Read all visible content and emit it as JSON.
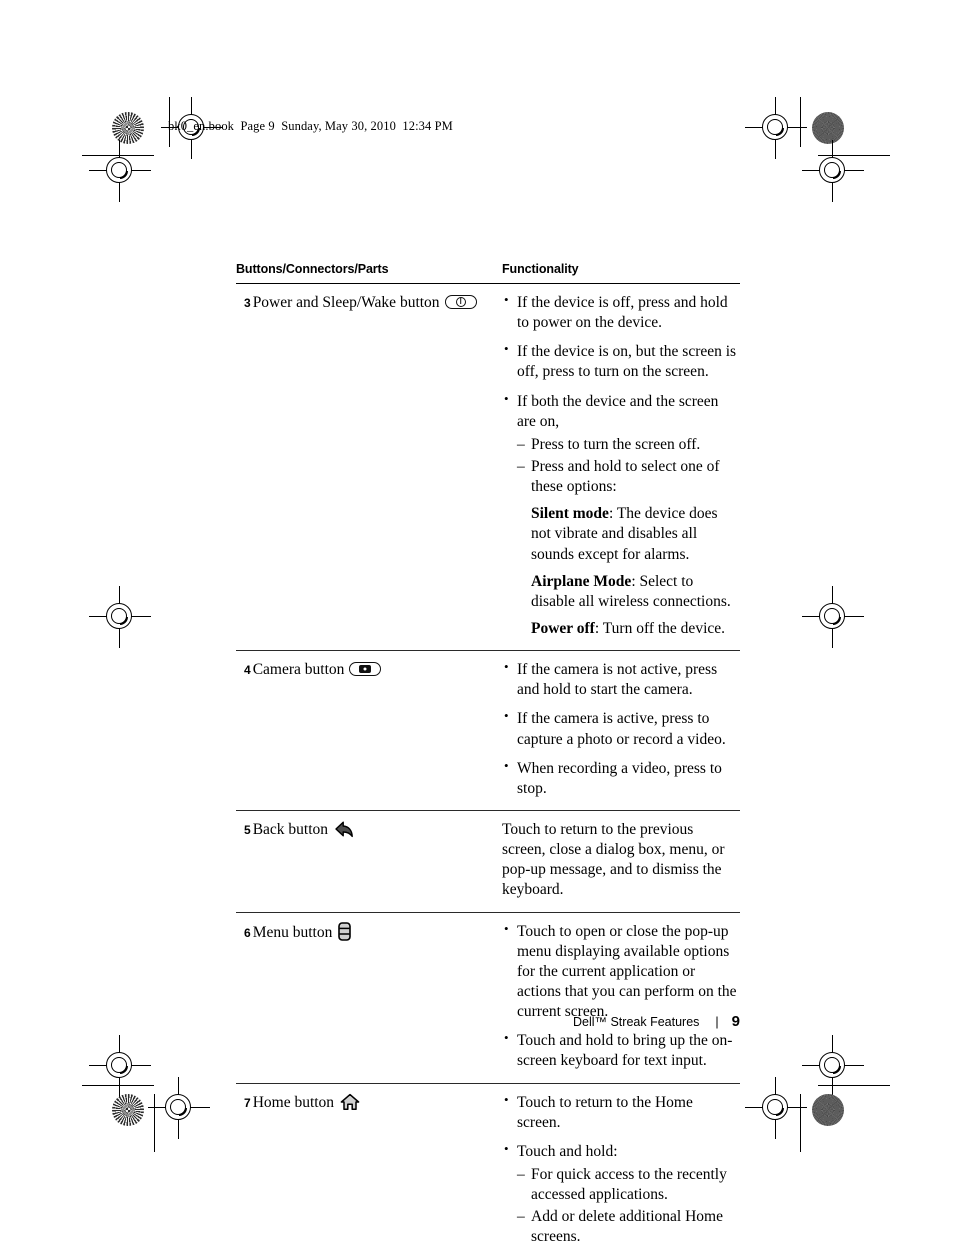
{
  "header": {
    "book_meta": "bk0_en.book  Page 9  Sunday, May 30, 2010  12:34 PM"
  },
  "table": {
    "columns": {
      "parts": "Buttons/Connectors/Parts",
      "functionality": "Functionality"
    },
    "rows": [
      {
        "number": "3",
        "label": "Power and Sleep/Wake button",
        "icon": "power-button-icon",
        "bullets": [
          "If the device is off, press and hold to power on the device.",
          "If the device is on, but the screen is off, press to turn on the screen.",
          "If both the device and the screen are on,"
        ],
        "sub_dashes": [
          "Press to turn the screen off.",
          "Press and hold to select one of these options:"
        ],
        "options": [
          {
            "term": "Silent mode",
            "desc": ": The device does not vibrate and disables all sounds except for alarms."
          },
          {
            "term": "Airplane Mode",
            "desc": ": Select to disable all wireless connections."
          },
          {
            "term": "Power off",
            "desc": ": Turn off the device."
          }
        ]
      },
      {
        "number": "4",
        "label": "Camera button",
        "icon": "camera-button-icon",
        "bullets": [
          "If the camera is not active, press and hold to start the camera.",
          "If the camera is active, press to capture a photo or record a video.",
          "When recording a video, press to stop."
        ]
      },
      {
        "number": "5",
        "label": "Back button",
        "icon": "back-arrow-icon",
        "paragraph": "Touch to return to the previous screen, close a dialog box, menu, or pop-up message, and to dismiss the keyboard."
      },
      {
        "number": "6",
        "label": "Menu button",
        "icon": "menu-icon",
        "bullets": [
          "Touch to open or close the pop-up menu displaying available options for the current application or actions that you can perform on the current screen.",
          "Touch and hold to bring up the on-screen keyboard for text input."
        ]
      },
      {
        "number": "7",
        "label": "Home button",
        "icon": "home-icon",
        "bullets": [
          "Touch to return to the Home screen.",
          "Touch and hold:"
        ],
        "sub_dashes": [
          "For quick access to the recently accessed applications.",
          "Add or delete additional Home screens."
        ]
      }
    ]
  },
  "footer": {
    "title": "Dell™ Streak Features",
    "separator": "|",
    "page_number": "9"
  }
}
